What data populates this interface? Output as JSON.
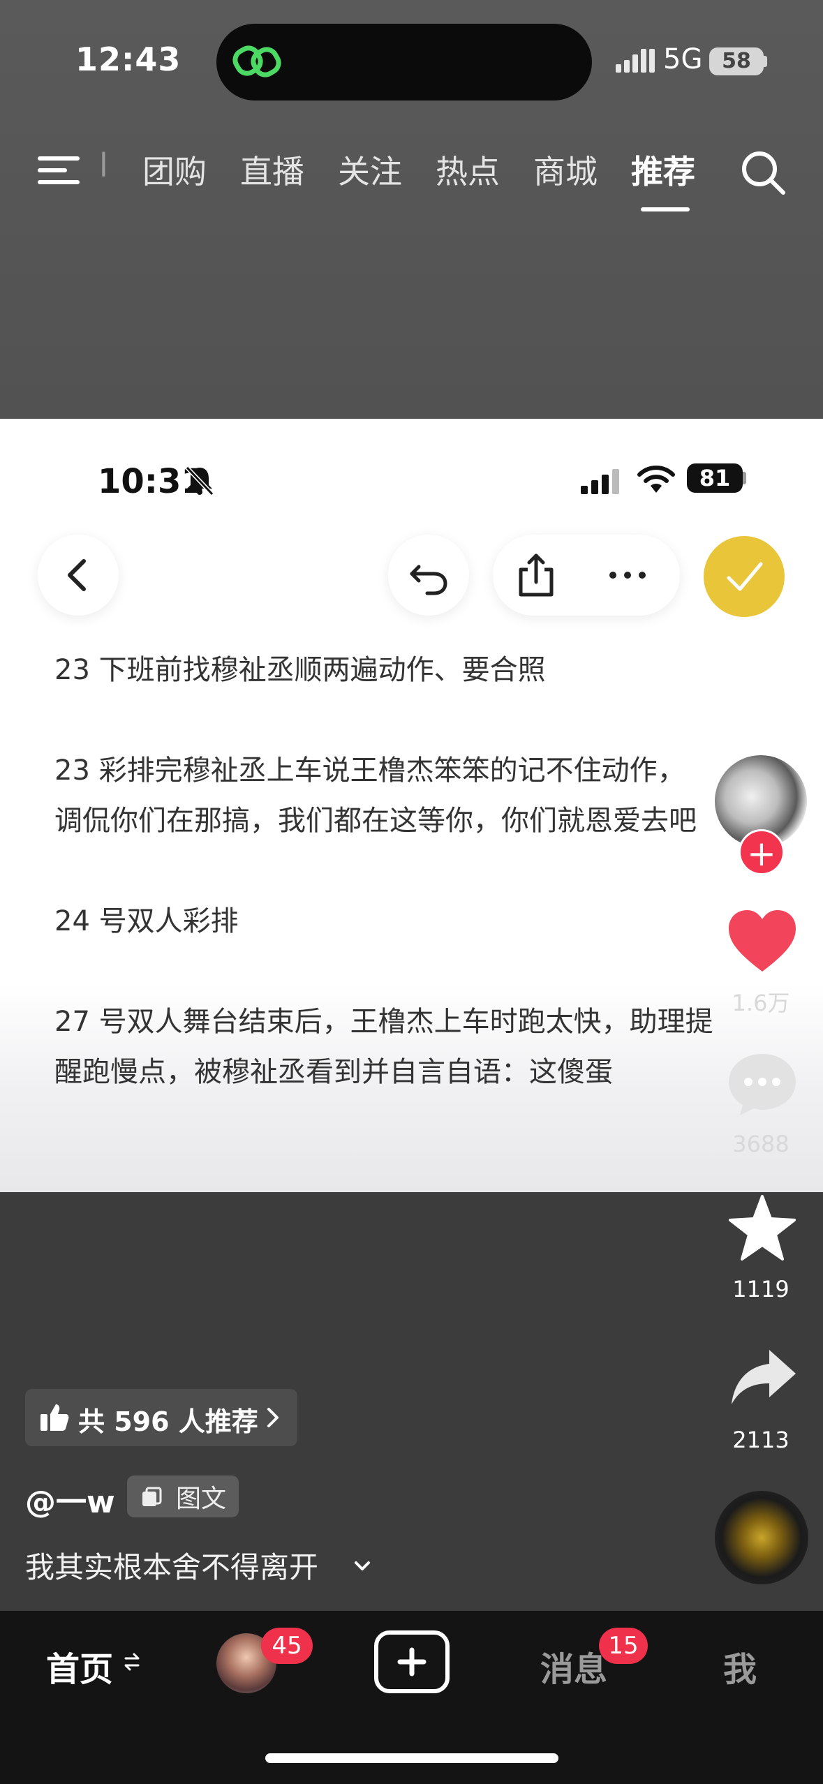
{
  "status_bar": {
    "time": "12:43",
    "network": "5G",
    "battery": "58"
  },
  "top_nav": {
    "partial_tab": "l",
    "tabs": [
      "团购",
      "直播",
      "关注",
      "热点",
      "商城",
      "推荐"
    ],
    "active_tab": "推荐"
  },
  "inner_status": {
    "time": "10:31",
    "battery": "81"
  },
  "post_text": {
    "lines": [
      "23 下班前找穆祉丞顺两遍动作、要合照",
      "23 彩排完穆祉丞上车说王橹杰笨笨的记不住动作，",
      "调侃你们在那搞，我们都在这等你，你们就恩爱去吧",
      "24 号双人彩排",
      "27 号双人舞台结束后，王橹杰上车时跑太快，助理提",
      "醒跑慢点，被穆祉丞看到并自言自语：这傻蛋"
    ]
  },
  "actions": {
    "like_count": "1.6万",
    "comment_count": "3688",
    "favorite_count": "1119",
    "share_count": "2113"
  },
  "caption": {
    "recommend_text": "共 596 人推荐",
    "username": "@一w",
    "tag": "图文",
    "description": "我其实根本舍不得离开"
  },
  "bottom_nav": {
    "home": "首页",
    "friends_badge": "45",
    "messages": "消息",
    "messages_badge": "15",
    "me": "我"
  },
  "colors": {
    "like_red": "#f2445a",
    "badge_red": "#f0314c",
    "check_yellow": "#e9c53a"
  }
}
